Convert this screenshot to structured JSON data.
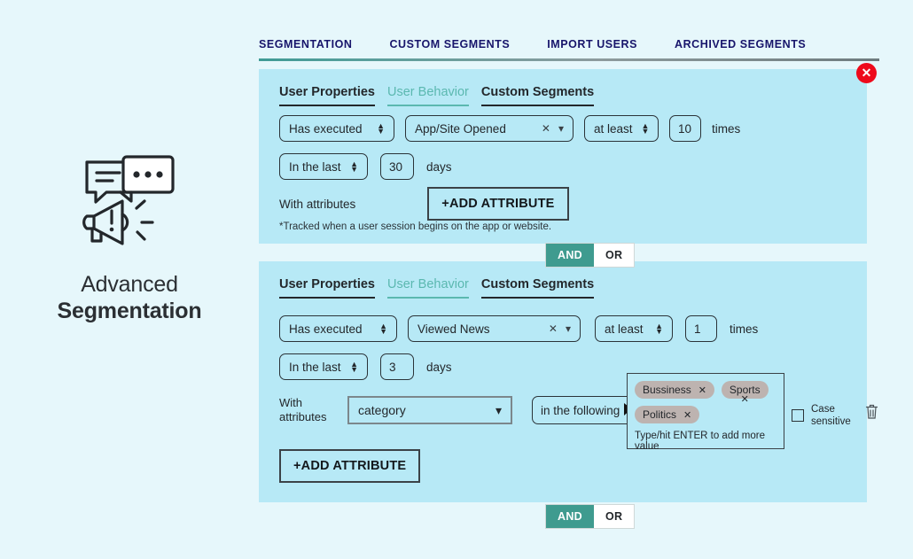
{
  "top_nav": {
    "items": [
      {
        "label": "SEGMENTATION"
      },
      {
        "label": "CUSTOM SEGMENTS"
      },
      {
        "label": "IMPORT USERS"
      },
      {
        "label": "ARCHIVED SEGMENTS"
      }
    ]
  },
  "promo": {
    "icon": "megaphone-speech-bubbles-icon",
    "title_line1": "Advanced",
    "title_line2": "Segmentation"
  },
  "close_button": {
    "label": "✕",
    "color": "#ee0a1b"
  },
  "card1": {
    "tabs": [
      {
        "label": "User Properties",
        "active": false
      },
      {
        "label": "User Behavior",
        "active": true
      },
      {
        "label": "Custom Segments",
        "active": false
      }
    ],
    "event_condition": "Has executed",
    "event_name": "App/Site Opened",
    "comparator": "at least",
    "count": "10",
    "count_unit": "times",
    "period_condition": "In the last",
    "period_value": "30",
    "period_unit": "days",
    "attributes_label": "With attributes",
    "add_attribute_label": "+ADD ATTRIBUTE",
    "footnote": "*Tracked when a user session begins on the app or website."
  },
  "joiner1": {
    "and_label": "AND",
    "or_label": "OR",
    "active": "AND"
  },
  "card2": {
    "tabs": [
      {
        "label": "User Properties",
        "active": false
      },
      {
        "label": "User Behavior",
        "active": true
      },
      {
        "label": "Custom Segments",
        "active": false
      }
    ],
    "event_condition": "Has executed",
    "event_name": "Viewed News",
    "comparator": "at least",
    "count": "1",
    "count_unit": "times",
    "period_condition": "In the last",
    "period_value": "3",
    "period_unit": "days",
    "attributes_label_line1": "With",
    "attributes_label_line2": "attributes",
    "attribute_name": "category",
    "attribute_condition": "in the following",
    "tags": [
      "Bussiness",
      "Sports",
      "Politics"
    ],
    "tag_remove_label": "✕",
    "tags_hint": "Type/hit ENTER to add more value",
    "case_sensitive_line1": "Case",
    "case_sensitive_line2": "sensitive",
    "delete_icon": "trash-icon",
    "add_attribute_label": "+ADD ATTRIBUTE"
  },
  "joiner2": {
    "and_label": "AND",
    "or_label": "OR",
    "active": "AND"
  },
  "spinner_glyph": "▲",
  "spinner_glyph_down": "▼",
  "clear_glyph": "✕",
  "caret_glyph": "▾",
  "colors": {
    "page_bg": "#e6f7fb",
    "card_bg": "#b7e9f6",
    "accent_teal": "#3f9b8f",
    "nav_text": "#17156b",
    "tab_active": "#5bb8b0",
    "tag_bg": "#bdb3b0",
    "danger": "#ee0a1b"
  }
}
